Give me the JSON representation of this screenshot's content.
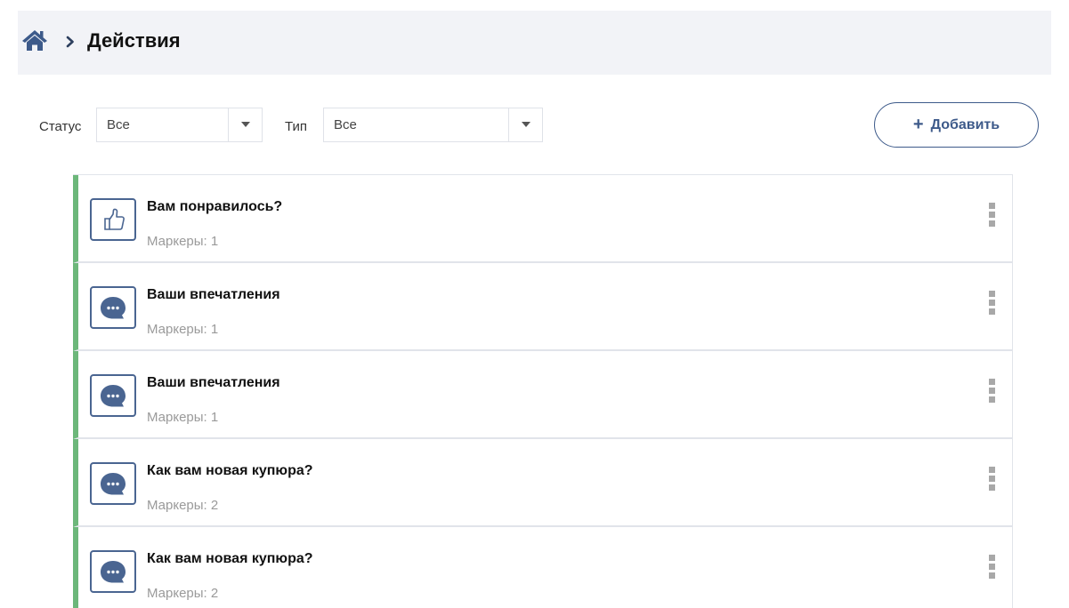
{
  "breadcrumb": {
    "title": "Действия",
    "home_icon": "home-icon",
    "separator_icon": "chevron-right-icon"
  },
  "filters": {
    "status": {
      "label": "Статус",
      "value": "Все"
    },
    "type": {
      "label": "Тип",
      "value": "Все"
    }
  },
  "toolbar": {
    "add_label": "Добавить",
    "add_icon": "plus-icon"
  },
  "colors": {
    "accent": "#3d5a8a",
    "status_active": "#6cb77a"
  },
  "actions": [
    {
      "title": "Вам понравилось?",
      "markers": "Маркеры: 1",
      "icon": "thumbs-up-icon"
    },
    {
      "title": "Ваши впечатления",
      "markers": "Маркеры: 1",
      "icon": "chat-bubble-icon"
    },
    {
      "title": "Ваши впечатления",
      "markers": "Маркеры: 1",
      "icon": "chat-bubble-icon"
    },
    {
      "title": "Как вам новая купюра?",
      "markers": "Маркеры: 2",
      "icon": "chat-bubble-icon"
    },
    {
      "title": "Как вам новая купюра?",
      "markers": "Маркеры: 2",
      "icon": "chat-bubble-icon"
    }
  ]
}
